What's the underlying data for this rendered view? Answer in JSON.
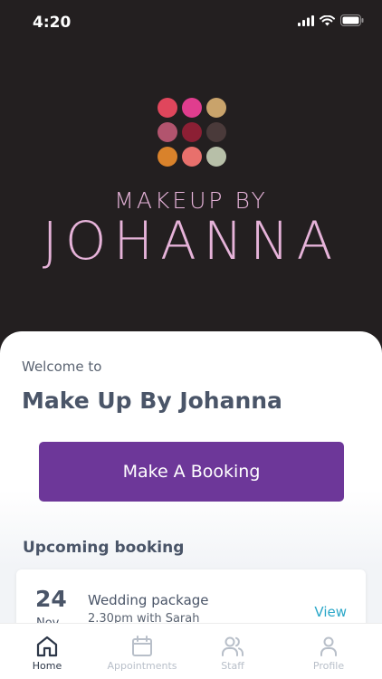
{
  "status_bar": {
    "time": "4:20"
  },
  "logo": {
    "line1": "MAKEUP BY",
    "line2": "JOHANNA",
    "dot_colors": [
      "#e0465c",
      "#e03d8e",
      "#c9a36b",
      "#b2546e",
      "#8c1f34",
      "#4a3a3a",
      "#d9822b",
      "#e8706c",
      "#b7bfa8"
    ]
  },
  "welcome": {
    "prefix": "Welcome to",
    "app_name": "Make Up By Johanna"
  },
  "actions": {
    "book_label": "Make A Booking"
  },
  "upcoming": {
    "title": "Upcoming booking",
    "booking": {
      "day": "24",
      "month": "Nov",
      "title": "Wedding package",
      "detail": "2.30pm with Sarah",
      "view_label": "View"
    }
  },
  "tabs": [
    {
      "label": "Home",
      "icon": "home-icon",
      "active": true
    },
    {
      "label": "Appointments",
      "icon": "calendar-icon",
      "active": false
    },
    {
      "label": "Staff",
      "icon": "users-icon",
      "active": false
    },
    {
      "label": "Profile",
      "icon": "user-icon",
      "active": false
    }
  ],
  "colors": {
    "accent": "#6d3799",
    "link": "#2aa7c8",
    "hero_bg": "#231f20",
    "logo_text": "#e6b3d9"
  }
}
